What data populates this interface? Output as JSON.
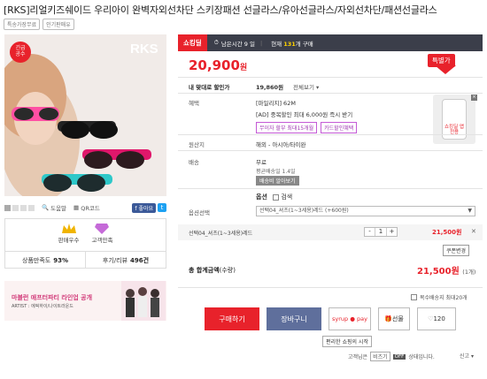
{
  "product": {
    "title": "[RKS]리얼키즈쉐이드 우리아이 완벽자외선차단 스키장패션 선글라스/유아선글라스/자외선차단/패션선글라스",
    "tags": [
      "특송가장무료",
      "인기판매유"
    ]
  },
  "image": {
    "brand": "RKS",
    "promo_badge_line1": "긴급",
    "promo_badge_line2": "공수"
  },
  "gallery": {
    "zoom_label": "도움말",
    "qr_label": "QR코드",
    "fb_like": "좋아요"
  },
  "badges": {
    "seller_badge": "판매우수",
    "satisfaction_badge": "고객만족",
    "satisfaction_label": "상품만족도",
    "satisfaction_value": "93%",
    "review_label": "후기/리뷰",
    "review_value": "496건"
  },
  "banner": {
    "headline": "마블런 애프터파티 라인업 공개",
    "sub": "ARTIST : 에픽하이/나이트라운드"
  },
  "deal": {
    "shock_label": "쇼킹딜",
    "time_label": "남은시간 9 일",
    "sold_prefix": "현재",
    "sold_count": "131",
    "sold_suffix": "개 구매",
    "price": "20,900",
    "price_unit": "원",
    "deal_tag": "특별가"
  },
  "info": {
    "my_discount_label": "내 맞대로 할인가",
    "my_discount_value": "19,860원",
    "my_discount_link": "전체보기",
    "benefit_label": "혜택",
    "benefit_line1": "[마일리지] 62M",
    "benefit_line2": "[AD] 중복할인 최대 6,000원 즉시 받기",
    "coupon1": "무이자 할부 최대15개월",
    "coupon2": "카드할인혜택",
    "origin_label": "원산지",
    "origin_value": "해외 - 아시아/타이완",
    "shipping_label": "배송",
    "shipping_value": "무료",
    "shipping_note": "평균배송일 1.4일",
    "shipping_btn": "배송비 알아보기",
    "option_title": "옵션",
    "option_search": "검색",
    "option_label": "옵션선택",
    "option_select": "선택04_셔츠(1~3세용)레드 (+600원)",
    "promo_phone": "쇼킹딜 앱전용"
  },
  "selection": {
    "name": "선택04_셔츠(1~3세용)레드",
    "qty": "1",
    "price": "21,500원",
    "coupon_change": "쿠폰변경"
  },
  "total": {
    "label": "총 합계금액",
    "label_sub": "(수량)",
    "price": "21,500원",
    "count": "(1개)"
  },
  "actions": {
    "multi_option": "복수배송지 최대20개",
    "buy": "구매하기",
    "cart": "장바구니",
    "syrup": "syrup ● pay",
    "gift": "선물",
    "like_count": "120",
    "tooltip": "편리한 쇼핑의 시작"
  },
  "footer": {
    "customer": "고객님은",
    "bizon": "비즈기",
    "off": "OFF",
    "status": "상태입니다.",
    "report": "신고"
  }
}
